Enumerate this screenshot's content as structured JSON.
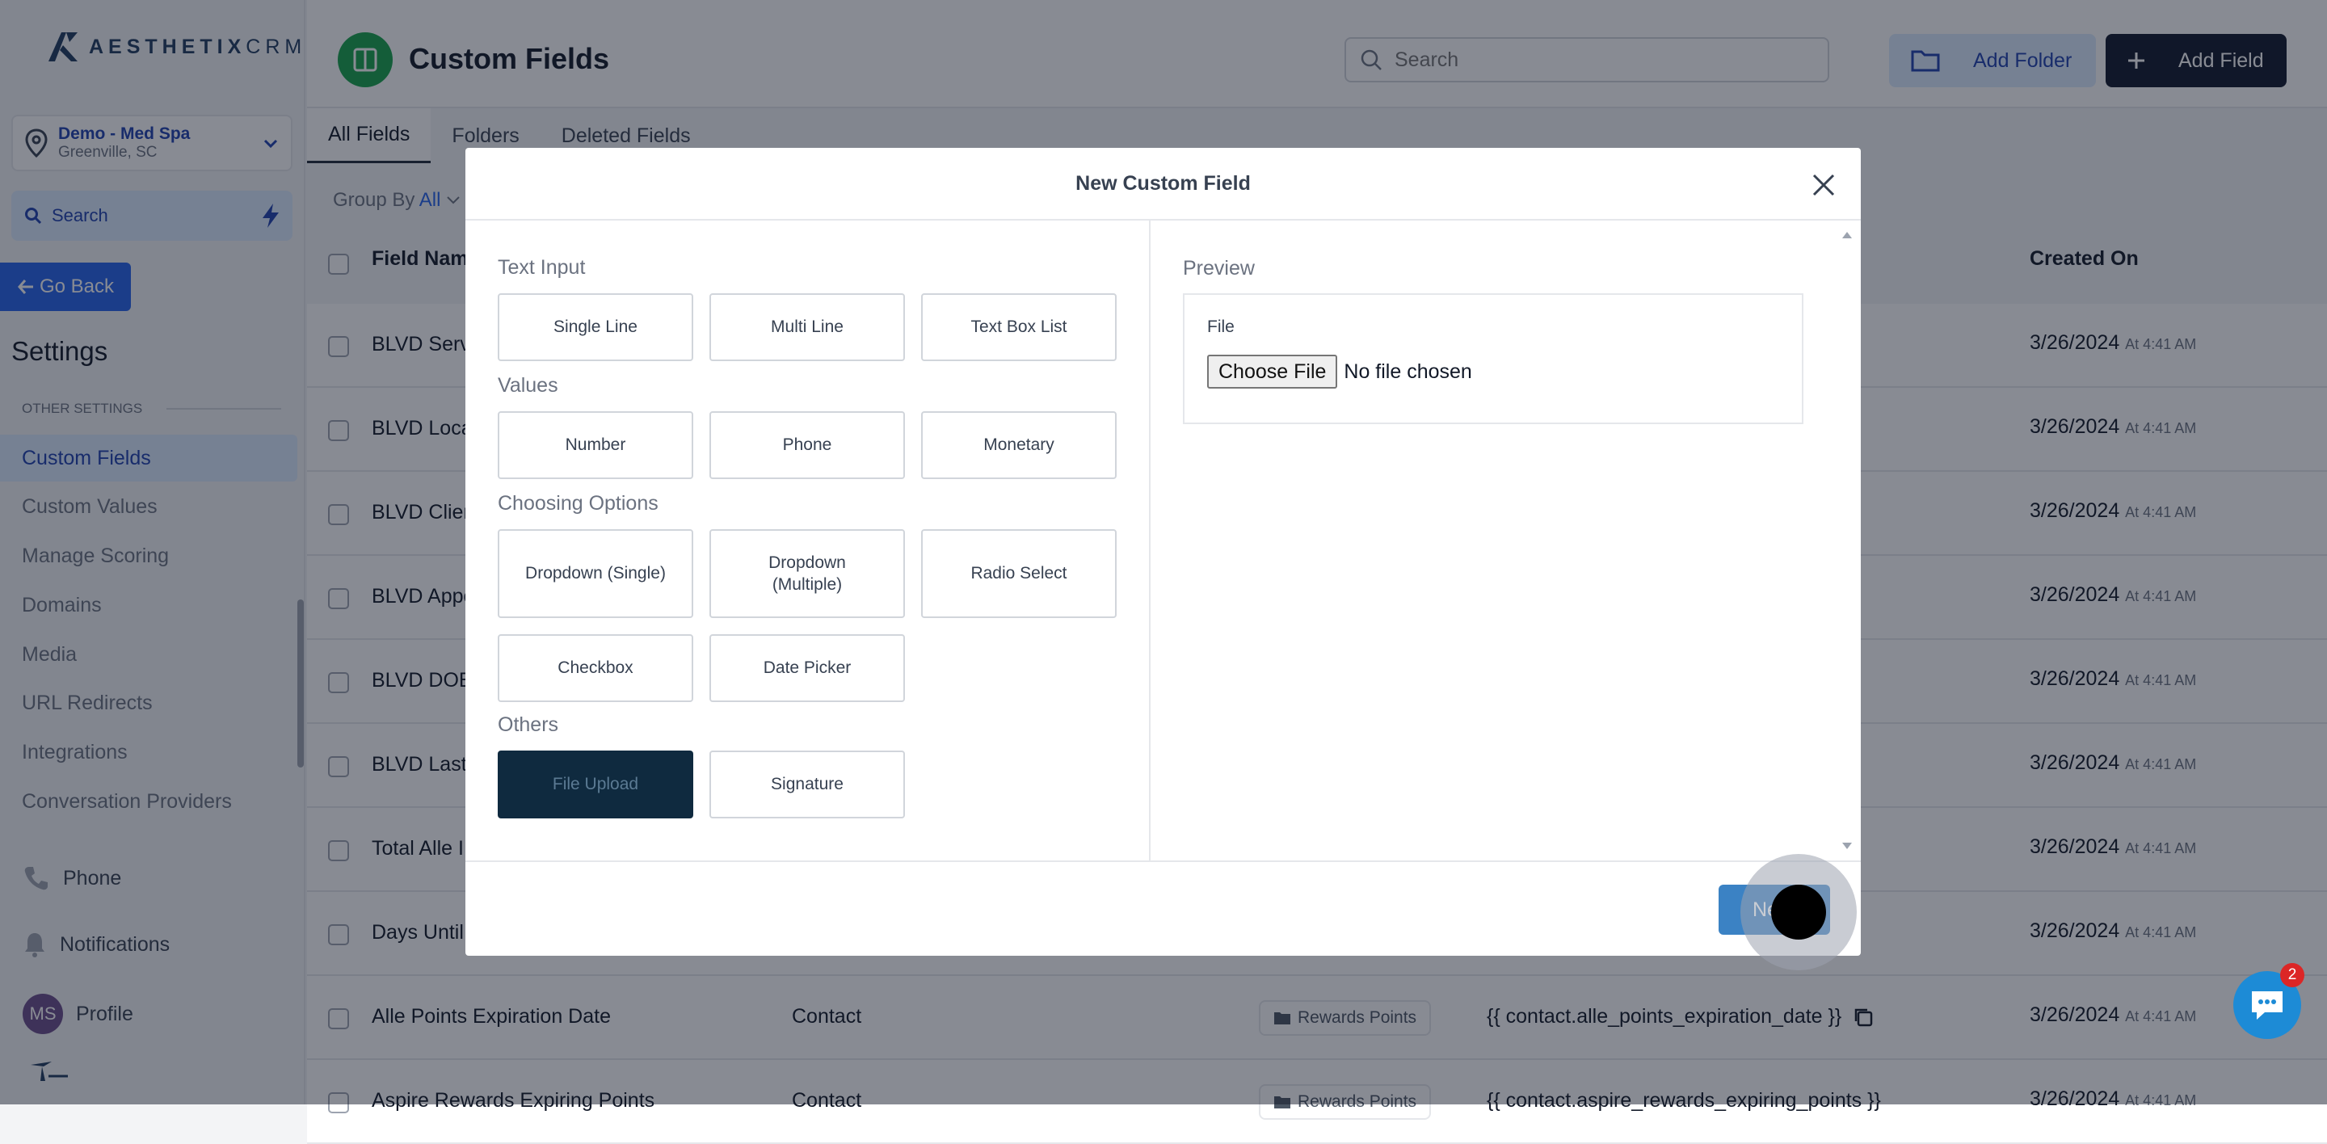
{
  "app": {
    "logo_prefix": "AESTHETIX",
    "logo_suffix": "CRM"
  },
  "location": {
    "name": "Demo - Med Spa",
    "city": "Greenville, SC"
  },
  "sidebar": {
    "search_label": "Search",
    "go_back_label": "Go Back",
    "section_title": "Settings",
    "group_label": "OTHER SETTINGS",
    "items": [
      {
        "label": "Custom Fields",
        "active": true
      },
      {
        "label": "Custom Values"
      },
      {
        "label": "Manage Scoring"
      },
      {
        "label": "Domains"
      },
      {
        "label": "Media"
      },
      {
        "label": "URL Redirects"
      },
      {
        "label": "Integrations"
      },
      {
        "label": "Conversation Providers"
      }
    ],
    "bottom": {
      "phone": "Phone",
      "notifications": "Notifications",
      "profile": "Profile",
      "avatar_initials": "MS"
    }
  },
  "header": {
    "title": "Custom Fields",
    "search_placeholder": "Search",
    "add_folder_label": "Add Folder",
    "add_field_label": "Add Field"
  },
  "tabs": [
    "All Fields",
    "Folders",
    "Deleted Fields"
  ],
  "group_by": {
    "label": "Group By",
    "value": "All"
  },
  "table": {
    "headers": {
      "name": "Field Nam",
      "created": "Created On"
    },
    "rows": [
      {
        "name": "BLVD Serv",
        "date": "3/26/2024",
        "time": "At 4:41 AM"
      },
      {
        "name": "BLVD Loca",
        "date": "3/26/2024",
        "time": "At 4:41 AM"
      },
      {
        "name": "BLVD Clier",
        "date": "3/26/2024",
        "time": "At 4:41 AM"
      },
      {
        "name": "BLVD Appo",
        "date": "3/26/2024",
        "time": "At 4:41 AM"
      },
      {
        "name": "BLVD DOB",
        "date": "3/26/2024",
        "time": "At 4:41 AM"
      },
      {
        "name": "BLVD Last",
        "date": "3/26/2024",
        "time": "At 4:41 AM"
      },
      {
        "name": "Total Alle I",
        "date": "3/26/2024",
        "time": "At 4:41 AM"
      },
      {
        "name": "Days Until",
        "date": "3/26/2024",
        "time": "At 4:41 AM"
      },
      {
        "name": "Alle Points Expiration Date",
        "object": "Contact",
        "folder": "Rewards Points",
        "key": "{{ contact.alle_points_expiration_date }}",
        "date": "3/26/2024",
        "time": "At 4:41 AM"
      },
      {
        "name": "Aspire Rewards Expiring Points",
        "object": "Contact",
        "folder": "Rewards Points",
        "key": "{{ contact.aspire_rewards_expiring_points }}",
        "date": "3/26/2024",
        "time": "At 4:41 AM"
      }
    ]
  },
  "modal": {
    "title": "New Custom Field",
    "sections": {
      "text_input": "Text Input",
      "values": "Values",
      "choosing": "Choosing Options",
      "others": "Others"
    },
    "options": {
      "single_line": "Single Line",
      "multi_line": "Multi Line",
      "text_box_list": "Text Box List",
      "number": "Number",
      "phone": "Phone",
      "monetary": "Monetary",
      "dropdown_single": "Dropdown (Single)",
      "dropdown_multiple": "Dropdown (Multiple)",
      "radio_select": "Radio Select",
      "checkbox": "Checkbox",
      "date_picker": "Date Picker",
      "file_upload": "File Upload",
      "signature": "Signature"
    },
    "selected_option": "File Upload",
    "preview": {
      "label": "Preview",
      "field_label": "File",
      "choose_file": "Choose File",
      "no_file": "No file chosen"
    },
    "next_label": "Next"
  },
  "chat_badge": "2",
  "colors": {
    "primary": "#2563eb",
    "dark": "#0f172a",
    "page_icon": "#16a34a"
  }
}
